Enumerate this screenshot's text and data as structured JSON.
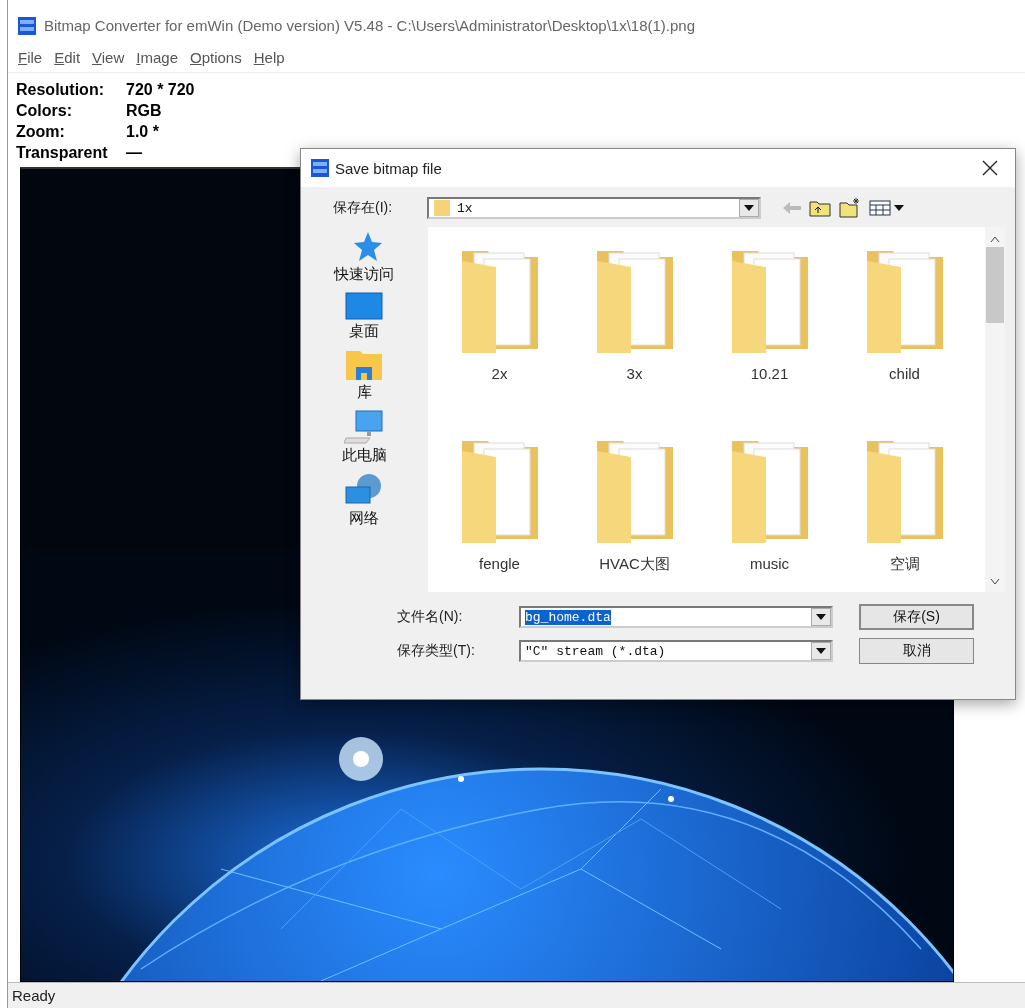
{
  "window": {
    "title": "Bitmap Converter for emWin (Demo version) V5.48 - C:\\Users\\Administrator\\Desktop\\1x\\18(1).png",
    "menu": [
      {
        "label": "File"
      },
      {
        "label": "Edit"
      },
      {
        "label": "View"
      },
      {
        "label": "Image"
      },
      {
        "label": "Options"
      },
      {
        "label": "Help"
      }
    ]
  },
  "info": [
    {
      "label": "Resolution:",
      "value": "720 * 720"
    },
    {
      "label": "Colors:",
      "value": "RGB"
    },
    {
      "label": "Zoom:",
      "value": "1.0 *"
    },
    {
      "label": "Transparent",
      "value": "—"
    }
  ],
  "dialog": {
    "title": "Save bitmap file",
    "save_in": {
      "label": "保存在(I):",
      "value": "1x"
    },
    "places": [
      {
        "label": "快速访问",
        "kind": "star"
      },
      {
        "label": "桌面",
        "kind": "desktop"
      },
      {
        "label": "库",
        "kind": "library"
      },
      {
        "label": "此电脑",
        "kind": "computer"
      },
      {
        "label": "网络",
        "kind": "network"
      }
    ],
    "files": [
      {
        "name": "2x"
      },
      {
        "name": "3x"
      },
      {
        "name": "10.21"
      },
      {
        "name": "child"
      },
      {
        "name": "fengle"
      },
      {
        "name": "HVAC大图"
      },
      {
        "name": "music"
      },
      {
        "name": "空调"
      }
    ],
    "file_name": {
      "label": "文件名(N):",
      "value": "bg_home.dta",
      "text_selected": true
    },
    "file_type": {
      "label": "保存类型(T):",
      "value": "\"C\" stream (*.dta)"
    },
    "buttons": [
      "保存(S)",
      "取消"
    ]
  },
  "status_bar": "Ready"
}
